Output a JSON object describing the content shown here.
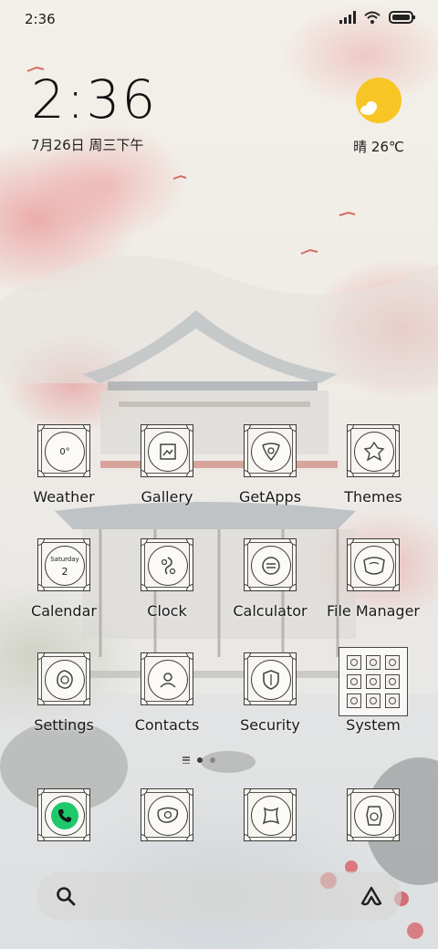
{
  "status_bar": {
    "time": "2:36",
    "icons": [
      "signal-icon",
      "wifi-icon",
      "battery-icon"
    ]
  },
  "clock_widget": {
    "time": "2:36",
    "date": "7月26日 周三下午"
  },
  "weather_widget": {
    "condition": "晴",
    "temperature": "26℃",
    "text": "晴 26℃",
    "icon": "partly-sunny-icon",
    "sun_color": "#f7c624"
  },
  "apps": [
    {
      "label": "Weather",
      "icon": "weather-icon",
      "glyph": "0°"
    },
    {
      "label": "Gallery",
      "icon": "gallery-icon"
    },
    {
      "label": "GetApps",
      "icon": "getapps-icon"
    },
    {
      "label": "Themes",
      "icon": "themes-icon"
    },
    {
      "label": "Calendar",
      "icon": "calendar-icon",
      "day": "Saturday",
      "num": "2"
    },
    {
      "label": "Clock",
      "icon": "clock-icon"
    },
    {
      "label": "Calculator",
      "icon": "calculator-icon"
    },
    {
      "label": "File Manager",
      "icon": "file-manager-icon"
    },
    {
      "label": "Settings",
      "icon": "settings-icon"
    },
    {
      "label": "Contacts",
      "icon": "contacts-icon"
    },
    {
      "label": "Security",
      "icon": "security-icon"
    },
    {
      "label": "System",
      "icon": "system-folder-icon"
    }
  ],
  "page_indicator": {
    "pages": 2,
    "current": 1
  },
  "dock": [
    {
      "icon": "phone-icon",
      "accent": "#1ec96a"
    },
    {
      "icon": "messages-icon"
    },
    {
      "icon": "browser-icon"
    },
    {
      "icon": "camera-icon"
    }
  ],
  "search_bar": {
    "left_icon": "search-icon",
    "right_icon": "assistant-icon"
  }
}
